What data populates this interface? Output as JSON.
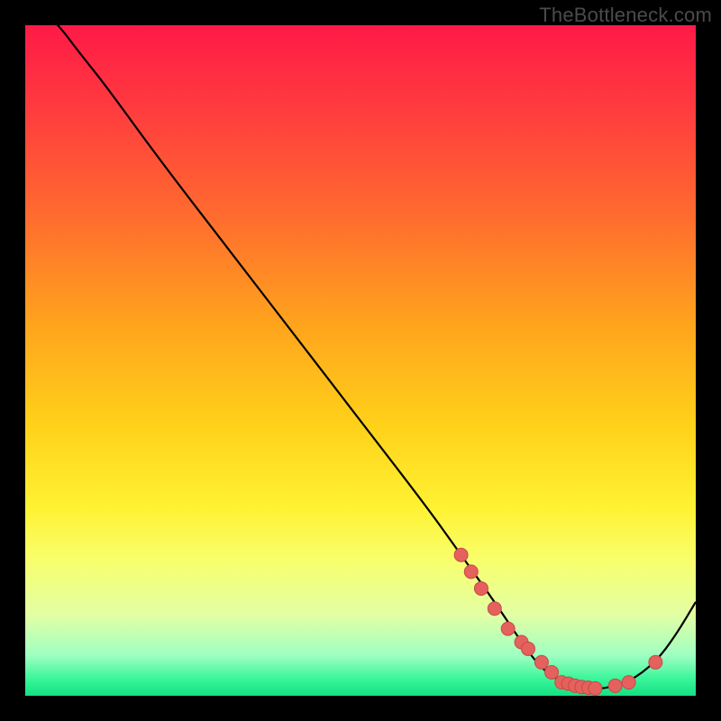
{
  "watermark": "TheBottleneck.com",
  "colors": {
    "bg": "#000000",
    "curve": "#000000",
    "marker_fill": "#e4615d",
    "marker_stroke": "#c74a46",
    "gradient_stops": [
      {
        "offset": 0.0,
        "color": "#ff1a47"
      },
      {
        "offset": 0.12,
        "color": "#ff3a3f"
      },
      {
        "offset": 0.28,
        "color": "#ff6a2f"
      },
      {
        "offset": 0.45,
        "color": "#ffa51c"
      },
      {
        "offset": 0.6,
        "color": "#ffd21a"
      },
      {
        "offset": 0.72,
        "color": "#fff233"
      },
      {
        "offset": 0.8,
        "color": "#f8ff6e"
      },
      {
        "offset": 0.88,
        "color": "#e2ffa5"
      },
      {
        "offset": 0.94,
        "color": "#9effc2"
      },
      {
        "offset": 0.975,
        "color": "#39f59a"
      },
      {
        "offset": 1.0,
        "color": "#14e083"
      }
    ]
  },
  "chart_data": {
    "type": "line",
    "title": "",
    "xlabel": "",
    "ylabel": "",
    "xlim": [
      0,
      100
    ],
    "ylim": [
      0,
      100
    ],
    "grid": false,
    "legend": false,
    "series": [
      {
        "name": "curve",
        "x": [
          0,
          5,
          8,
          12,
          20,
          30,
          40,
          50,
          60,
          65,
          70,
          74,
          77,
          80,
          83,
          86,
          90,
          94,
          97,
          100
        ],
        "y": [
          105,
          100,
          96,
          91,
          80,
          67,
          54,
          41,
          28,
          21,
          14,
          8,
          4,
          2,
          1,
          1,
          2,
          5,
          9,
          14
        ]
      }
    ],
    "markers": {
      "name": "highlight-points",
      "x": [
        65,
        66.5,
        68,
        70,
        72,
        74,
        75,
        77,
        78.5,
        80,
        81,
        82,
        83,
        84,
        85,
        88,
        90,
        94
      ],
      "y": [
        21,
        18.5,
        16,
        13,
        10,
        8,
        7,
        5,
        3.5,
        2,
        1.8,
        1.5,
        1.3,
        1.2,
        1.1,
        1.5,
        2,
        5
      ]
    }
  }
}
